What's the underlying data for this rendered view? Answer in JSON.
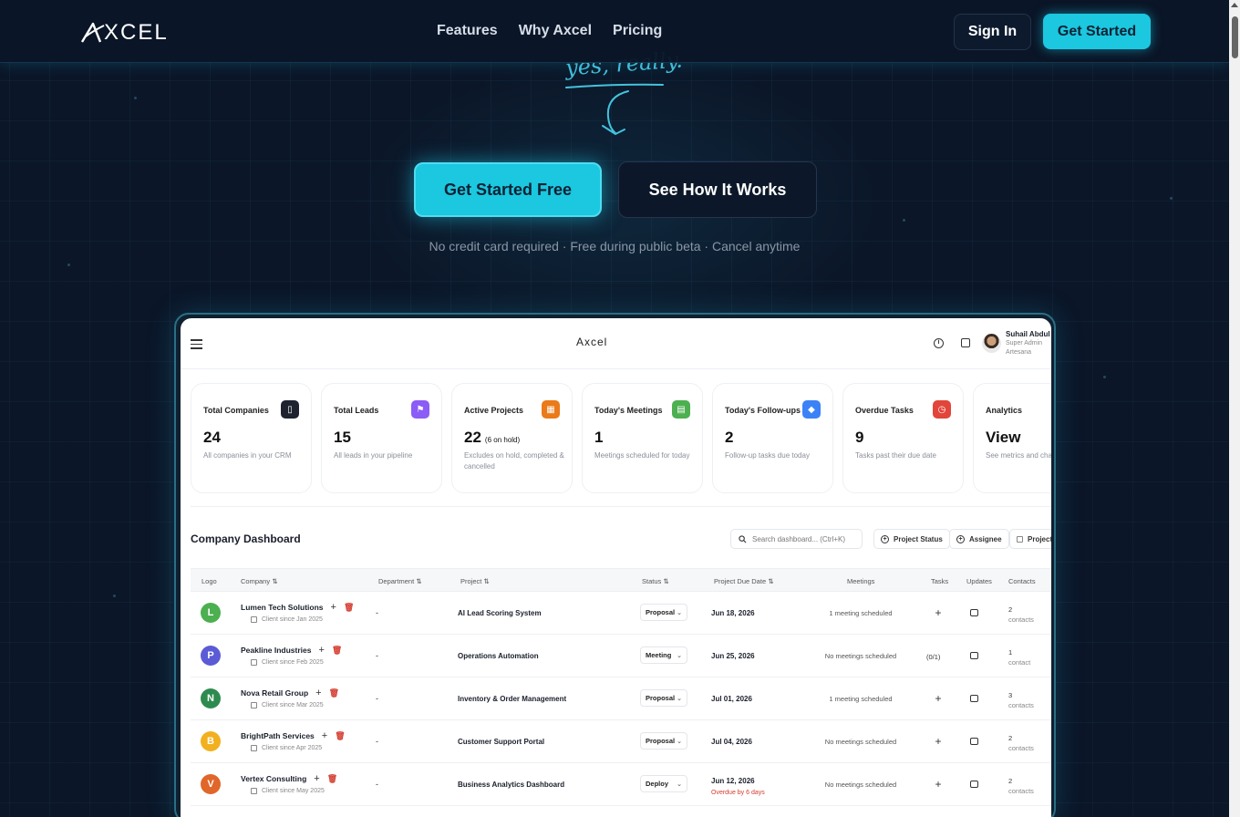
{
  "nav": {
    "brand": "XCEL",
    "links": [
      "Features",
      "Why Axcel",
      "Pricing"
    ],
    "sign_in": "Sign In",
    "get_started": "Get Started"
  },
  "hero": {
    "handwritten_note": "yes, really.",
    "cta_primary": "Get Started Free",
    "cta_secondary": "See How It Works",
    "subtext": "No credit card required · Free during public beta · Cancel anytime"
  },
  "app": {
    "logo": "Axcel",
    "user": {
      "name": "Suhail Abdul",
      "role": "Super Admin",
      "org": "Artesana"
    },
    "cards": [
      {
        "title": "Total Companies",
        "value": "24",
        "note": "",
        "desc": "All companies in your CRM",
        "icon": "building-icon",
        "color": "#1f2330",
        "glyph": "▯"
      },
      {
        "title": "Total Leads",
        "value": "15",
        "note": "",
        "desc": "All leads in your pipeline",
        "icon": "leads-icon",
        "color": "#8b5cf6",
        "glyph": "⚑"
      },
      {
        "title": "Active Projects",
        "value": "22",
        "note": "(6 on hold)",
        "desc": "Excludes on hold, completed & cancelled",
        "icon": "briefcase-icon",
        "color": "#ea7a1a",
        "glyph": "▦"
      },
      {
        "title": "Today's Meetings",
        "value": "1",
        "note": "",
        "desc": "Meetings scheduled for today",
        "icon": "calendar-icon",
        "color": "#4caf50",
        "glyph": "▤"
      },
      {
        "title": "Today's Follow-ups",
        "value": "2",
        "note": "",
        "desc": "Follow-up tasks due today",
        "icon": "followup-icon",
        "color": "#3b82f6",
        "glyph": "◆"
      },
      {
        "title": "Overdue Tasks",
        "value": "9",
        "note": "",
        "desc": "Tasks past their due date",
        "icon": "clock-icon",
        "color": "#e2453a",
        "glyph": "◷"
      },
      {
        "title": "Analytics",
        "value": "View",
        "note": "",
        "desc": "See metrics and charts",
        "icon": "chart-icon",
        "color": "#ffffff",
        "glyph": ""
      }
    ],
    "dashboard": {
      "title": "Company Dashboard",
      "search_placeholder": "Search dashboard... (Ctrl+K)",
      "filters": [
        "Project Status",
        "Assignee",
        "Projects"
      ],
      "columns": [
        "Logo",
        "Company",
        "Department",
        "Project",
        "Status",
        "Project Due Date",
        "Meetings",
        "Tasks",
        "Updates",
        "Contacts"
      ],
      "rows": [
        {
          "initial": "L",
          "color": "#4caf50",
          "company": "Lumen Tech Solutions",
          "since": "Client since Jan 2025",
          "dept": "-",
          "project": "AI Lead Scoring System",
          "status": "Proposal",
          "due": "Jun 18, 2026",
          "due_note": "",
          "meetings": "1 meeting scheduled",
          "tasks": "+",
          "contacts_n": "2",
          "contacts_l": "contacts"
        },
        {
          "initial": "P",
          "color": "#5b5bd6",
          "company": "Peakline Industries",
          "since": "Client since Feb 2025",
          "dept": "-",
          "project": "Operations Automation",
          "status": "Meeting",
          "due": "Jun 25, 2026",
          "due_note": "",
          "meetings": "No meetings scheduled",
          "tasks": "(0/1)",
          "contacts_n": "1",
          "contacts_l": "contact"
        },
        {
          "initial": "N",
          "color": "#2e8b4f",
          "company": "Nova Retail Group",
          "since": "Client since Mar 2025",
          "dept": "-",
          "project": "Inventory & Order Management",
          "status": "Proposal",
          "due": "Jul 01, 2026",
          "due_note": "",
          "meetings": "1 meeting scheduled",
          "tasks": "+",
          "contacts_n": "3",
          "contacts_l": "contacts"
        },
        {
          "initial": "B",
          "color": "#f2b01e",
          "company": "BrightPath Services",
          "since": "Client since Apr 2025",
          "dept": "-",
          "project": "Customer Support Portal",
          "status": "Proposal",
          "due": "Jul 04, 2026",
          "due_note": "",
          "meetings": "No meetings scheduled",
          "tasks": "+",
          "contacts_n": "2",
          "contacts_l": "contacts"
        },
        {
          "initial": "V",
          "color": "#e0662a",
          "company": "Vertex Consulting",
          "since": "Client since May 2025",
          "dept": "-",
          "project": "Business Analytics Dashboard",
          "status": "Deploy",
          "due": "Jun 12, 2026",
          "due_note": "Overdue by 6 days",
          "meetings": "No meetings scheduled",
          "tasks": "+",
          "contacts_n": "2",
          "contacts_l": "contacts"
        }
      ]
    }
  }
}
